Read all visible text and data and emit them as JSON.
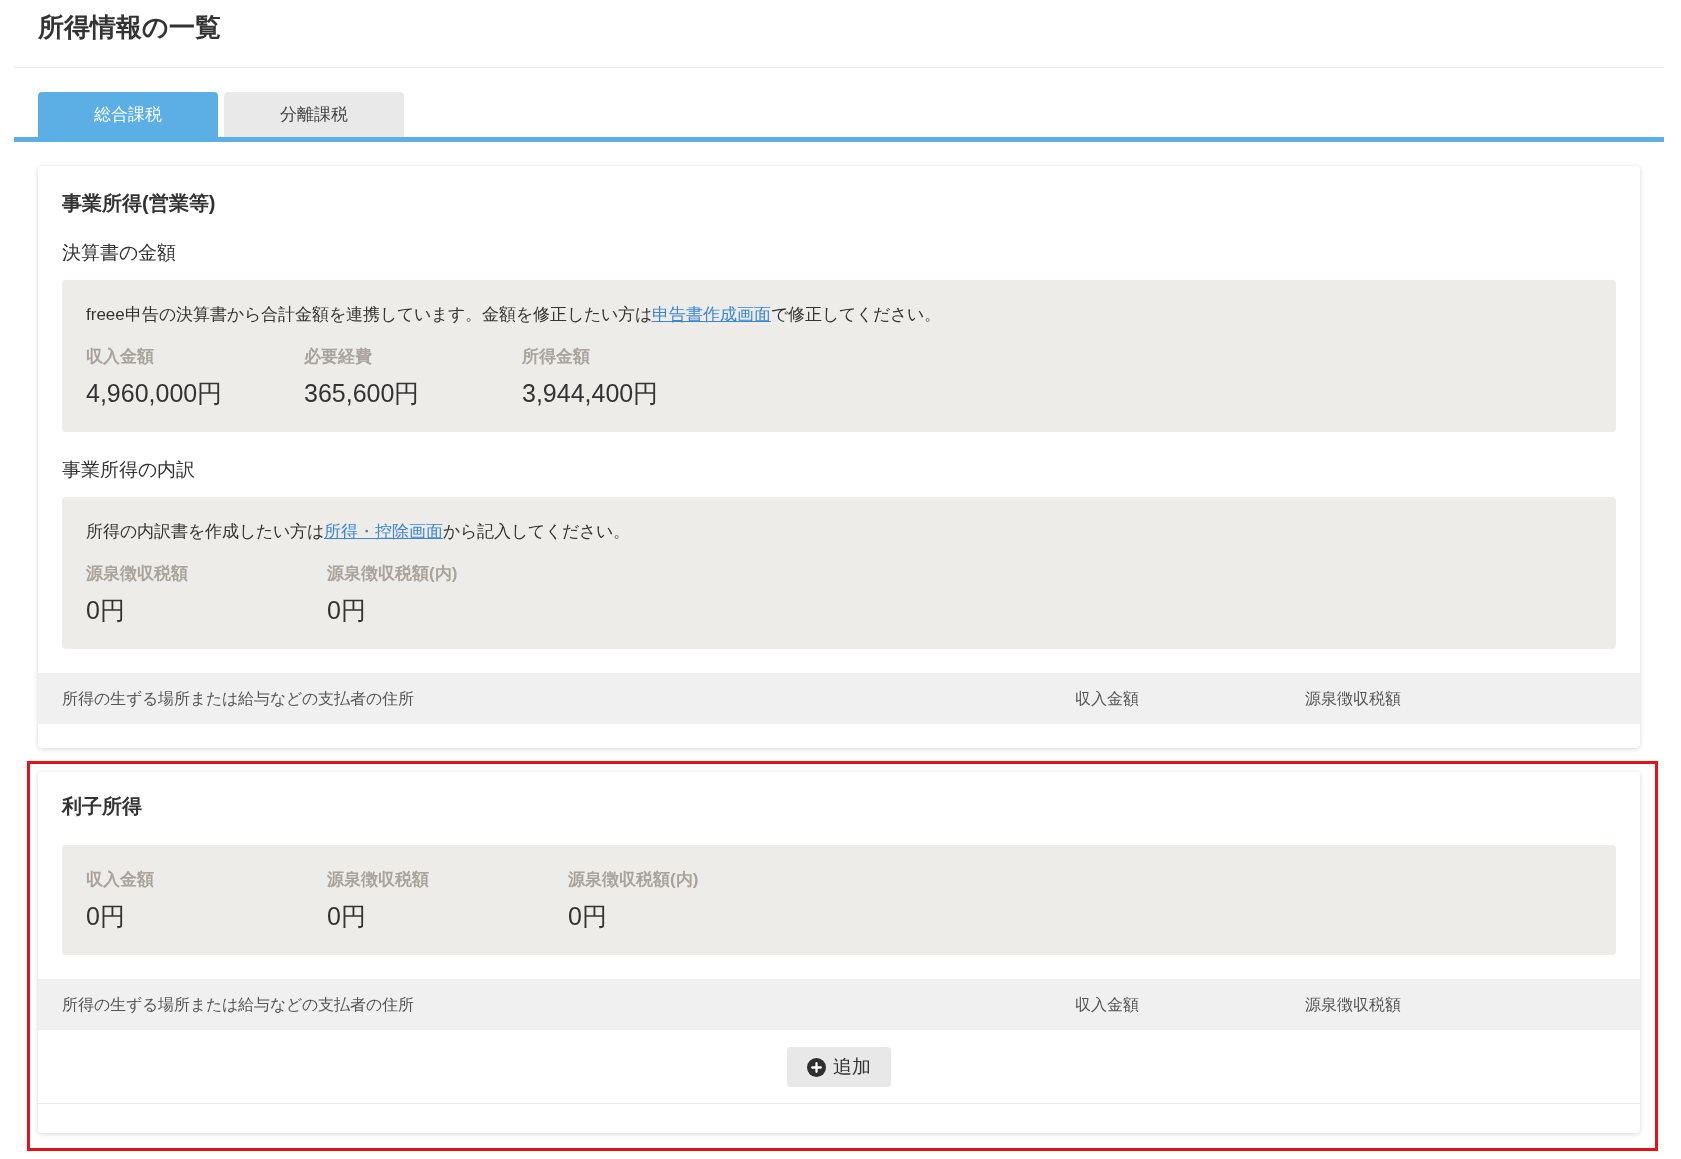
{
  "page": {
    "title": "所得情報の一覧"
  },
  "tabs": [
    {
      "label": "総合課税",
      "selected": true
    },
    {
      "label": "分離課税",
      "selected": false
    }
  ],
  "sections": [
    {
      "title": "事業所得(営業等)",
      "highlighted": false,
      "groups": [
        {
          "heading": "決算書の金額",
          "note": {
            "before": "freee申告の決算書から合計金額を連携しています。金額を修正したい方は",
            "link": "申告書作成画面",
            "after": "で修正してください。"
          },
          "fields": [
            {
              "label": "収入金額",
              "value": "4,960,000円"
            },
            {
              "label": "必要経費",
              "value": "365,600円"
            },
            {
              "label": "所得金額",
              "value": "3,944,400円"
            }
          ]
        },
        {
          "heading": "事業所得の内訳",
          "note": {
            "before": "所得の内訳書を作成したい方は",
            "link": "所得・控除画面",
            "after": "から記入してください。"
          },
          "fields": [
            {
              "label": "源泉徴収税額",
              "value": "0円"
            },
            {
              "label": "源泉徴収税額(内)",
              "value": "0円"
            }
          ]
        }
      ],
      "table": {
        "columns": [
          "所得の生ずる場所または給与などの支払者の住所",
          "収入金額",
          "源泉徴収税額"
        ]
      }
    },
    {
      "title": "利子所得",
      "highlighted": true,
      "groups": [
        {
          "fields": [
            {
              "label": "収入金額",
              "value": "0円"
            },
            {
              "label": "源泉徴収税額",
              "value": "0円"
            },
            {
              "label": "源泉徴収税額(内)",
              "value": "0円"
            }
          ]
        }
      ],
      "table": {
        "columns": [
          "所得の生ずる場所または給与などの支払者の住所",
          "収入金額",
          "源泉徴収税額"
        ]
      },
      "add_button": {
        "label": "追加"
      }
    }
  ]
}
